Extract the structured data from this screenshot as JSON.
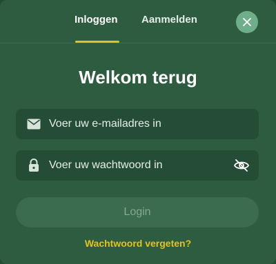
{
  "tabs": {
    "login_label": "Inloggen",
    "signup_label": "Aanmelden",
    "active": "login"
  },
  "close_icon": "close-icon",
  "heading": "Welkom terug",
  "email": {
    "icon": "envelope-icon",
    "placeholder": "Voer uw e-mailadres in",
    "value": ""
  },
  "password": {
    "icon": "lock-icon",
    "placeholder": "Voer uw wachtwoord in",
    "value": "",
    "visibility_icon": "eye-off-icon"
  },
  "login_button": {
    "label": "Login",
    "disabled": true
  },
  "forgot_password": "Wachtwoord vergeten?",
  "colors": {
    "background": "#2e5c40",
    "field_background": "#254d35",
    "accent": "#e4c320",
    "close_button": "#6fae8a",
    "disabled_button": "#3c6c4f"
  }
}
